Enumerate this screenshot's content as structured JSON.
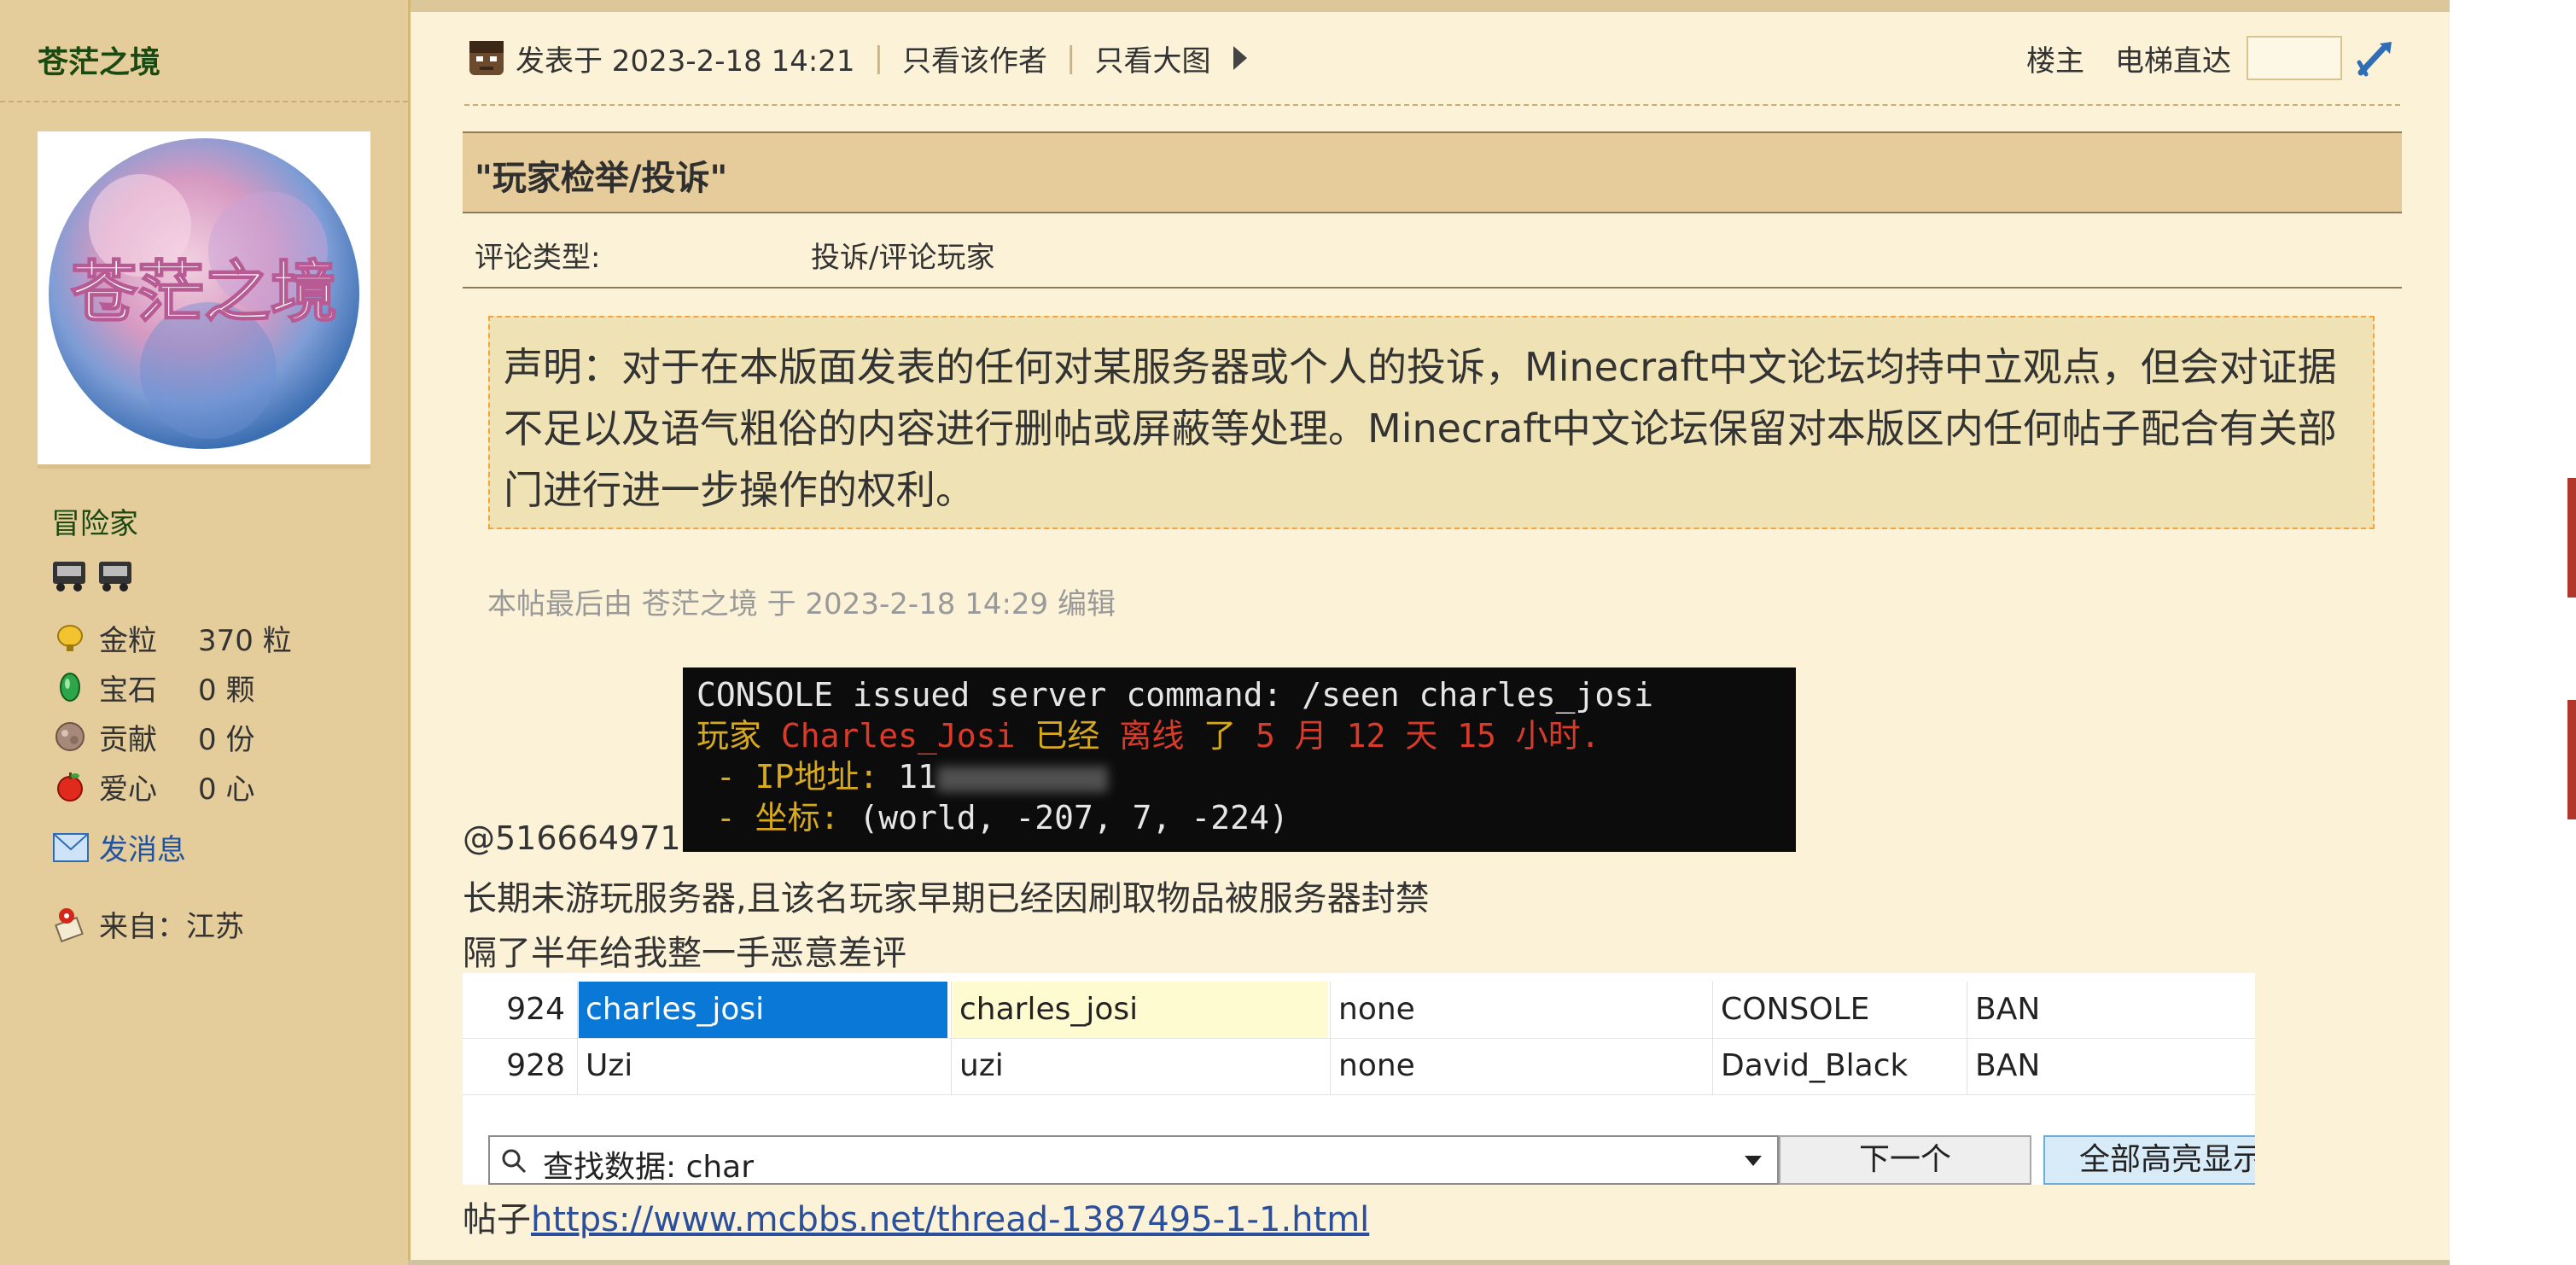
{
  "author": {
    "name": "苍茫之境",
    "avatar_text": "苍茫之境"
  },
  "profile": {
    "rank": "冒险家",
    "stats": [
      {
        "icon": "gold-nugget-icon",
        "label": "金粒",
        "value": "370 粒"
      },
      {
        "icon": "emerald-icon",
        "label": "宝石",
        "value": "0 颗"
      },
      {
        "icon": "contribution-icon",
        "label": "贡献",
        "value": "0 份"
      },
      {
        "icon": "apple-heart-icon",
        "label": "爱心",
        "value": "0 心"
      }
    ],
    "send_message": "发消息",
    "from": "来自：江苏"
  },
  "post_header": {
    "posted": "发表于 2023-2-18 14:21",
    "sep": "|",
    "only_author": "只看该作者",
    "only_images": "只看大图",
    "floor": "楼主",
    "elevator": "电梯直达"
  },
  "post": {
    "title": "\"玩家检举/投诉\"",
    "type_label": "评论类型:",
    "type_value": "投诉/评论玩家",
    "notice": "声明：对于在本版面发表的任何对某服务器或个人的投诉，Minecraft中文论坛均持中立观点，但会对证据不足以及语气粗俗的内容进行删帖或屏蔽等处理。Minecraft中文论坛保留对本版区内任何帖子配合有关部门进行进一步操作的权利。",
    "edited": "本帖最后由 苍茫之境 于 2023-2-18 14:29 编辑",
    "console": {
      "line1": "CONSOLE issued server command: /seen charles_josi",
      "line2_a": "玩家 ",
      "line2_b": "Charles_Josi",
      "line2_c": " 已经 ",
      "line2_d": "离线",
      "line2_e": " 了 ",
      "line2_f": "5 月 12 天 15 小时.",
      "line3": " - IP地址: ",
      "line3_partial": "11",
      "line4_a": " - 坐标: ",
      "line4_b": "(world, -207, 7, -224)"
    },
    "mention": "@516664971",
    "body1": "长期未游玩服务器,且该名玩家早期已经因刷取物品被服务器封禁",
    "body2": "隔了半年给我整一手恶意差评",
    "link_prefix": "帖子",
    "link": "https://www.mcbbs.net/thread-1387495-1-1.html"
  },
  "db_table": {
    "rows": [
      [
        "924",
        "charles_josi",
        "charles_josi",
        "none",
        "CONSOLE",
        "BAN"
      ],
      [
        "928",
        "Uzi",
        "uzi",
        "none",
        "David_Black",
        "BAN"
      ]
    ],
    "find_label": "查找数据: char",
    "next": "下一个",
    "highlight_all": "全部高亮显示"
  }
}
